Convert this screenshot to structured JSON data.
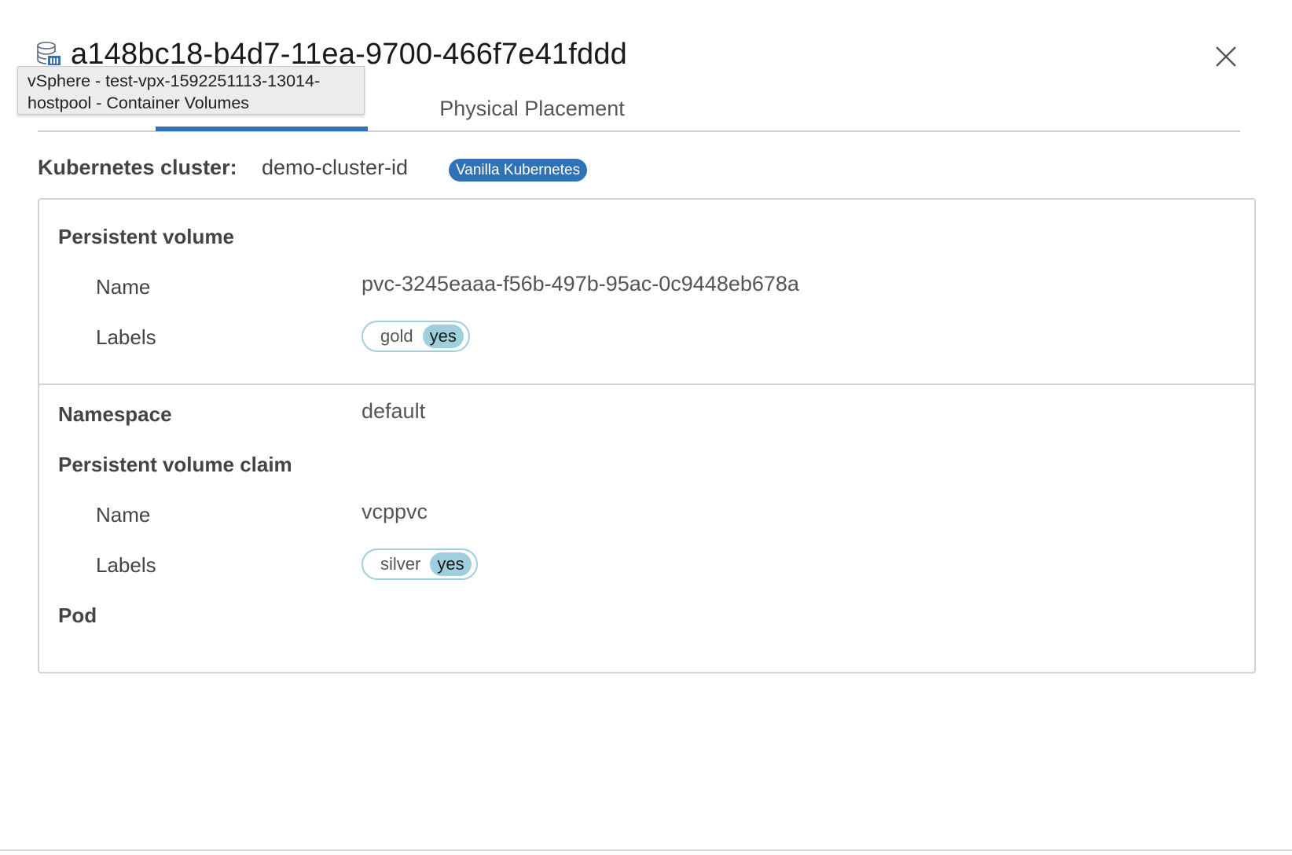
{
  "dialog": {
    "title": "a148bc18-b4d7-11ea-9700-466f7e41fddd",
    "icon": "database-volume-icon",
    "close_icon": "close-icon"
  },
  "tooltip": {
    "line1": "vSphere - test-vpx-1592251113-13014-",
    "line2": "hostpool - Container Volumes"
  },
  "tabs": [
    {
      "label": "",
      "active": true
    },
    {
      "label": "Physical Placement",
      "active": false
    }
  ],
  "cluster": {
    "label": "Kubernetes cluster:",
    "value": "demo-cluster-id",
    "badge": "Vanilla Kubernetes"
  },
  "persistent_volume": {
    "heading": "Persistent volume",
    "name_label": "Name",
    "name_value": "pvc-3245eaaa-f56b-497b-95ac-0c9448eb678a",
    "labels_label": "Labels",
    "labels": [
      {
        "key": "gold",
        "value": "yes"
      }
    ]
  },
  "namespace": {
    "label": "Namespace",
    "value": "default"
  },
  "persistent_volume_claim": {
    "heading": "Persistent volume claim",
    "name_label": "Name",
    "name_value": "vcppvc",
    "labels_label": "Labels",
    "labels": [
      {
        "key": "silver",
        "value": "yes"
      }
    ]
  },
  "pod": {
    "label": "Pod"
  },
  "colors": {
    "accent": "#2f73b6",
    "label_pill": "#9fcfdd",
    "border": "#d3d3d3"
  }
}
